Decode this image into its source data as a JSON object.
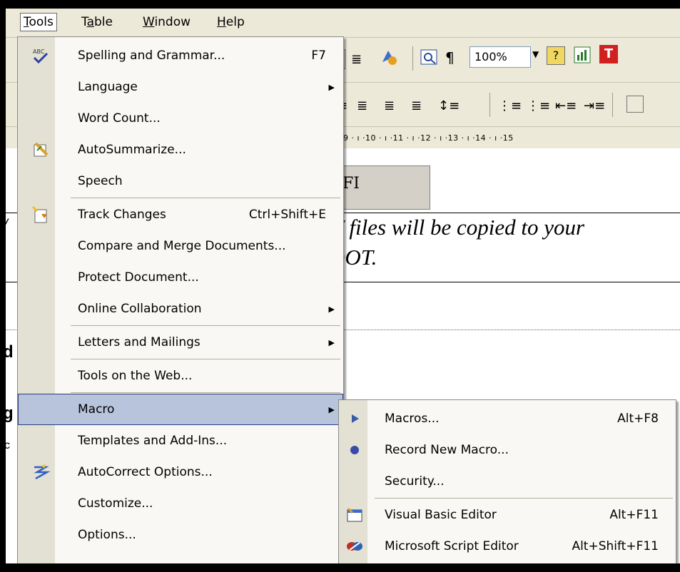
{
  "menubar": {
    "items": [
      {
        "label": "Tools",
        "active": true
      },
      {
        "label": "Table",
        "active": false
      },
      {
        "label": "Window",
        "active": false
      },
      {
        "label": "Help",
        "active": false
      }
    ]
  },
  "toolbar": {
    "zoom_value": "100%"
  },
  "ruler": {
    "text": "· 9 · ı ·10 · ı ·11 · ı ·12 · ı ·13 · ı ·14 · ı ·15"
  },
  "document": {
    "button_text": "FI",
    "italic_line_1": "/ files will be copied to your",
    "italic_line_2": ")OT.",
    "left_letter_1": "/",
    "left_letter_2": "d",
    "left_letter_3": "g",
    "left_letter_4": "c"
  },
  "tools_menu": {
    "items": [
      {
        "label": "Spelling and Grammar...",
        "shortcut": "F7",
        "icon": "spelling-icon"
      },
      {
        "label": "Language",
        "submenu": true
      },
      {
        "label": "Word Count..."
      },
      {
        "label": "AutoSummarize...",
        "icon": "autosummarize-icon"
      },
      {
        "label": "Speech"
      },
      {
        "label": "Track Changes",
        "shortcut": "Ctrl+Shift+E",
        "icon": "track-changes-icon"
      },
      {
        "label": "Compare and Merge Documents..."
      },
      {
        "label": "Protect Document..."
      },
      {
        "label": "Online Collaboration",
        "submenu": true
      },
      {
        "label": "Letters and Mailings",
        "submenu": true
      },
      {
        "label": "Tools on the Web..."
      },
      {
        "label": "Macro",
        "submenu": true,
        "highlighted": true
      },
      {
        "label": "Templates and Add-Ins..."
      },
      {
        "label": "AutoCorrect Options...",
        "icon": "autocorrect-icon"
      },
      {
        "label": "Customize..."
      },
      {
        "label": "Options..."
      }
    ]
  },
  "macro_submenu": {
    "items": [
      {
        "label": "Macros...",
        "shortcut": "Alt+F8",
        "icon": "play-icon"
      },
      {
        "label": "Record New Macro...",
        "icon": "record-icon"
      },
      {
        "label": "Security..."
      },
      {
        "label": "Visual Basic Editor",
        "shortcut": "Alt+F11",
        "icon": "vb-editor-icon"
      },
      {
        "label": "Microsoft Script Editor",
        "shortcut": "Alt+Shift+F11",
        "icon": "script-editor-icon"
      }
    ]
  },
  "colors": {
    "highlight": "#b8c4dc",
    "highlight_border": "#2a3c78",
    "menu_bg": "#f9f8f4",
    "gutter": "#e3e0d4",
    "chrome": "#ece9d8"
  }
}
